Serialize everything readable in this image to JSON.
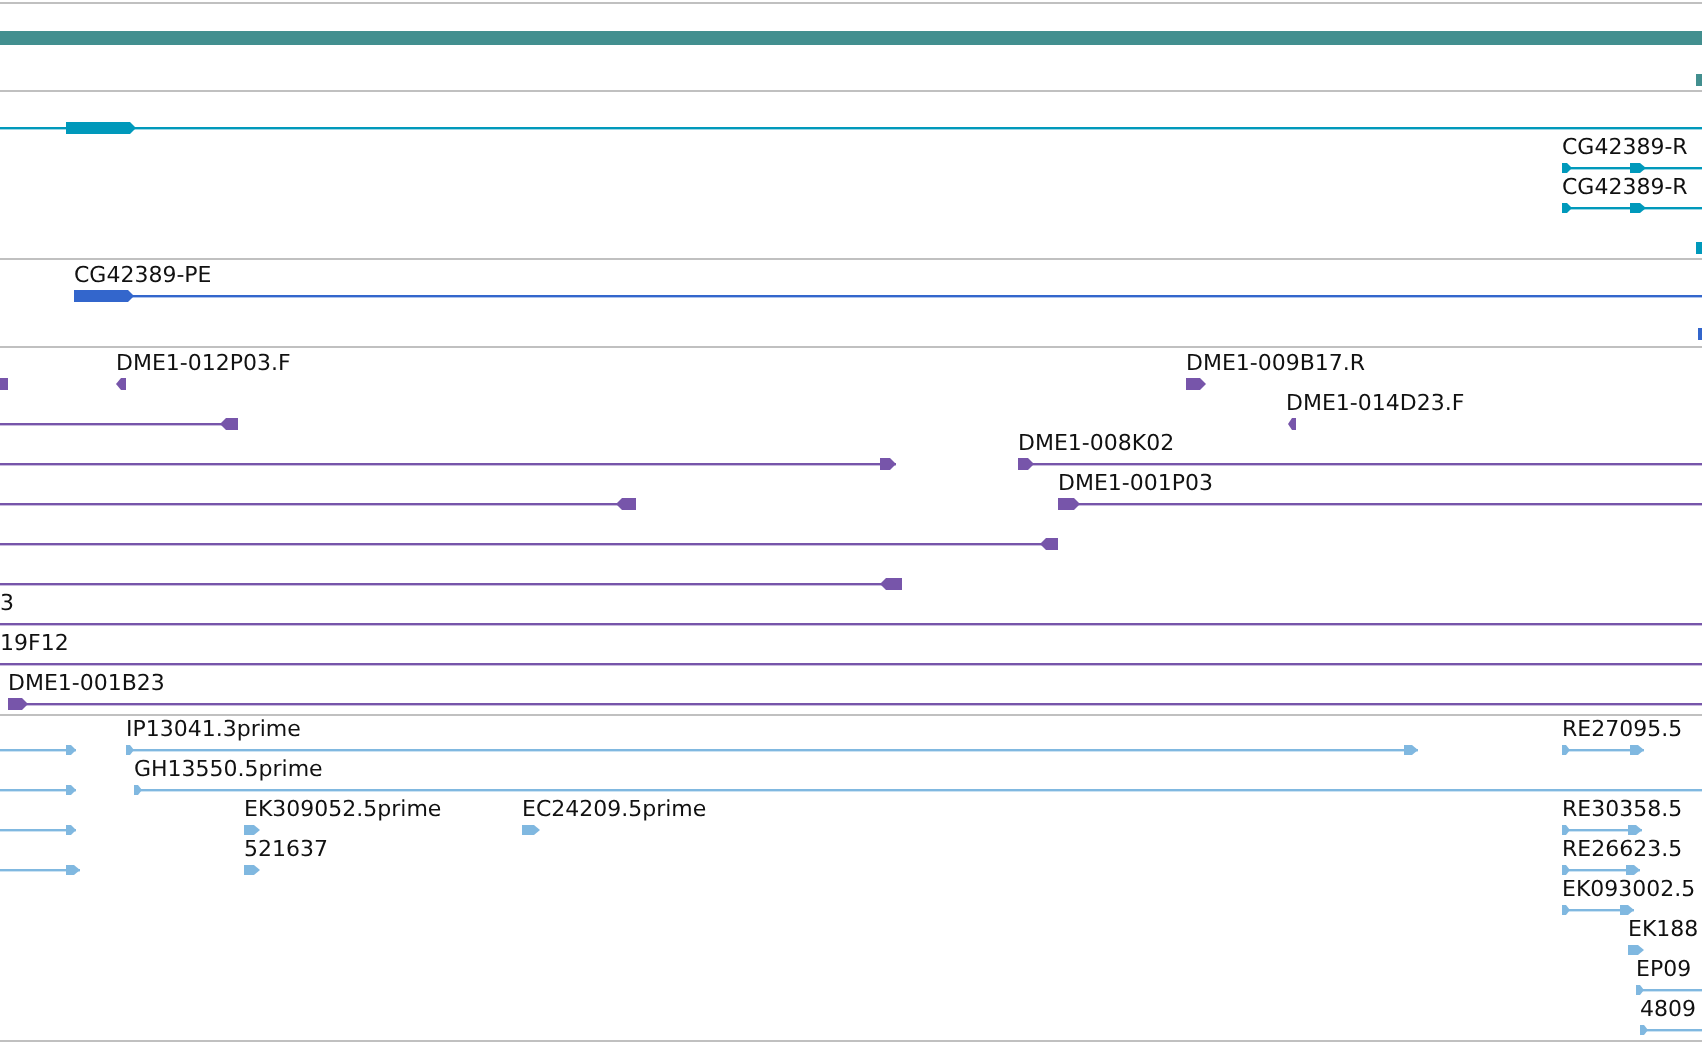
{
  "tracks": [
    {
      "color": "#428f8f",
      "features": [
        {
          "kind": "bar"
        },
        {
          "kind": "block"
        }
      ]
    },
    {
      "color": "#0099bb",
      "features": [
        {
          "kind": "arrow",
          "reverse": false
        },
        {
          "kind": "arrow",
          "reverse": false,
          "label": "CG42389-R"
        },
        {
          "kind": "arrow",
          "reverse": false,
          "label": "CG42389-R"
        },
        {
          "kind": "block"
        }
      ]
    },
    {
      "color": "#3366cc",
      "features": [
        {
          "kind": "arrow",
          "reverse": false,
          "label": "CG42389-PE"
        },
        {
          "kind": "block"
        }
      ]
    },
    {
      "color": "#7755aa",
      "features": [
        {
          "kind": "block"
        },
        {
          "kind": "arrow",
          "reverse": true,
          "label": "DME1-012P03.F"
        },
        {
          "kind": "arrow",
          "reverse": false,
          "label": "DME1-009B17.R"
        },
        {
          "kind": "arrow",
          "reverse": true
        },
        {
          "kind": "arrow",
          "reverse": true,
          "label": "DME1-014D23.F"
        },
        {
          "kind": "arrow",
          "reverse": false
        },
        {
          "kind": "arrow",
          "reverse": false,
          "label": "DME1-008K02"
        },
        {
          "kind": "arrow",
          "reverse": true
        },
        {
          "kind": "arrow",
          "reverse": false,
          "label": "DME1-001P03"
        },
        {
          "kind": "arrow",
          "reverse": true
        },
        {
          "kind": "arrow",
          "reverse": true
        },
        {
          "kind": "line",
          "label": "3"
        },
        {
          "kind": "line",
          "label": "19F12"
        },
        {
          "kind": "arrow",
          "reverse": false,
          "label": "DME1-001B23"
        }
      ]
    },
    {
      "color": "#80b8e0",
      "features": [
        {
          "kind": "arrow",
          "reverse": false
        },
        {
          "kind": "arrow",
          "reverse": false,
          "label": "IP13041.3prime"
        },
        {
          "kind": "arrow",
          "reverse": false,
          "label": "RE27095.5"
        },
        {
          "kind": "arrow",
          "reverse": false
        },
        {
          "kind": "arrow",
          "reverse": false,
          "label": "GH13550.5prime"
        },
        {
          "kind": "arrow",
          "reverse": false
        },
        {
          "kind": "arrow",
          "reverse": false,
          "label": "EK309052.5prime"
        },
        {
          "kind": "arrow",
          "reverse": false,
          "label": "EC24209.5prime"
        },
        {
          "kind": "arrow",
          "reverse": false,
          "label": "RE30358.5"
        },
        {
          "kind": "arrow",
          "reverse": false
        },
        {
          "kind": "arrow",
          "reverse": false,
          "label": "521637"
        },
        {
          "kind": "arrow",
          "reverse": false,
          "label": "RE26623.5"
        },
        {
          "kind": "arrow",
          "reverse": false,
          "label": "EK093002.5"
        },
        {
          "kind": "arrow",
          "reverse": false,
          "label": "EK188"
        },
        {
          "kind": "arrow",
          "reverse": false,
          "label": "EP09"
        },
        {
          "kind": "arrow",
          "reverse": false,
          "label": "4809"
        }
      ]
    }
  ]
}
